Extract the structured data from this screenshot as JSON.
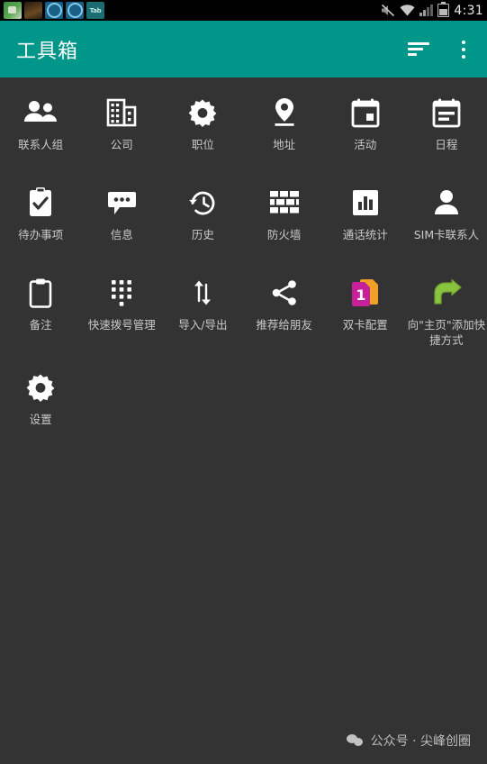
{
  "status_bar": {
    "time": "4:31",
    "left_icons": [
      "map-app-icon",
      "dark-app-icon",
      "blue-app-icon-1",
      "blue-app-icon-2",
      "tab-app-icon"
    ],
    "tab_icon_label": "Tab",
    "right_icons": [
      "mute-icon",
      "wifi-icon",
      "signal-icon",
      "battery-icon"
    ]
  },
  "app_bar": {
    "title": "工具箱",
    "sort_label": "sort-icon",
    "overflow_label": "overflow-menu-icon"
  },
  "colors": {
    "accent": "#00968a",
    "background": "#333333",
    "status_bar": "#000000",
    "label": "#c9c9c9",
    "icon": "#ffffff",
    "sim_card_front": "#c6219b",
    "sim_card_back": "#f0a024",
    "shortcut_arrow": "#8ac43f"
  },
  "grid": {
    "items": [
      {
        "label": "联系人组",
        "icon": "people-group-icon"
      },
      {
        "label": "公司",
        "icon": "building-icon"
      },
      {
        "label": "职位",
        "icon": "gear-icon"
      },
      {
        "label": "地址",
        "icon": "location-pin-icon"
      },
      {
        "label": "活动",
        "icon": "calendar-event-icon"
      },
      {
        "label": "日程",
        "icon": "calendar-agenda-icon"
      },
      {
        "label": "待办事项",
        "icon": "clipboard-check-icon"
      },
      {
        "label": "信息",
        "icon": "chat-bubble-icon"
      },
      {
        "label": "历史",
        "icon": "history-clock-icon"
      },
      {
        "label": "防火墙",
        "icon": "brick-wall-icon"
      },
      {
        "label": "通话统计",
        "icon": "bar-chart-icon"
      },
      {
        "label": "SIM卡联系人",
        "icon": "person-icon"
      },
      {
        "label": "备注",
        "icon": "clipboard-icon"
      },
      {
        "label": "快速拨号管理",
        "icon": "dialpad-icon"
      },
      {
        "label": "导入/导出",
        "icon": "import-export-arrows-icon"
      },
      {
        "label": "推荐给朋友",
        "icon": "share-icon"
      },
      {
        "label": "双卡配置",
        "icon": "dual-sim-card-icon"
      },
      {
        "label": "向\"主页\"添加快捷方式",
        "icon": "green-curved-arrow-icon"
      },
      {
        "label": "设置",
        "icon": "gear-icon"
      }
    ]
  },
  "watermark": {
    "text": "公众号 · 尖峰创圈",
    "icon": "wechat-icon"
  }
}
